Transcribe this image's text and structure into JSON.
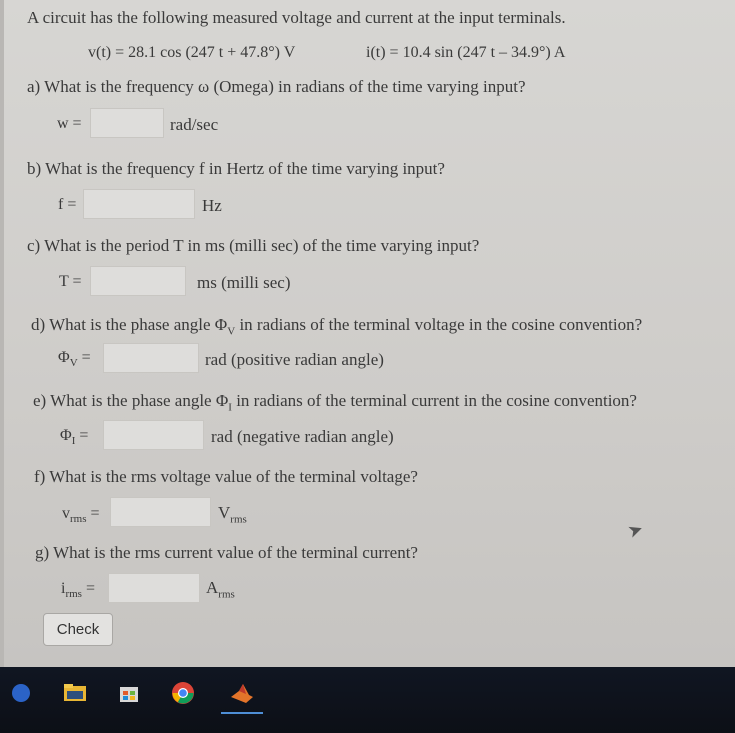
{
  "problem": {
    "intro": "A circuit has the following measured voltage and current at the input terminals.",
    "voltage_expr": "v(t) = 28.1 cos (247 t + 47.8°) V",
    "current_expr": "i(t)  = 10.4 sin (247 t – 34.9°) A"
  },
  "questions": [
    {
      "text": "a) What is the frequency ω (Omega) in radians of the time varying input?",
      "label": "w =",
      "unit": "rad/sec",
      "value": ""
    },
    {
      "text": "b) What is the frequency f in Hertz of the time varying input?",
      "label": "f =",
      "unit": "Hz",
      "value": ""
    },
    {
      "text": "c) What is the period T in ms (milli sec) of the time varying input?",
      "label": "T =",
      "unit": "ms (milli sec)",
      "value": ""
    },
    {
      "text_pre": "d) What is the phase angle Φ",
      "text_sub": "V",
      "text_post": " in radians of the terminal voltage in the cosine convention?",
      "label_main": "Φ",
      "label_sub": "V",
      "label_eq": " =",
      "unit": "rad  (positive radian angle)",
      "value": ""
    },
    {
      "text_pre": "e) What is the phase angle Φ",
      "text_sub": "I",
      "text_post": " in radians of the terminal current in the cosine convention?",
      "label_main": "Φ",
      "label_sub": "I",
      "label_eq": " =",
      "unit": "rad  (negative radian angle)",
      "value": ""
    },
    {
      "text": "f) What is the rms voltage value of the terminal voltage?",
      "label_main": "v",
      "label_sub": "rms",
      "label_eq": " =",
      "unit_main": "V",
      "unit_sub": "rms",
      "value": ""
    },
    {
      "text": "g) What is the rms current value of the terminal current?",
      "label_main": "i",
      "label_sub": "rms",
      "label_eq": " =",
      "unit_main": "A",
      "unit_sub": "rms",
      "value": ""
    }
  ],
  "check_button": "Check",
  "taskbar": {
    "icons": [
      "windows-icon",
      "file-explorer-icon",
      "store-icon",
      "chrome-icon",
      "matlab-icon"
    ],
    "accent": "#4e8ed6"
  }
}
